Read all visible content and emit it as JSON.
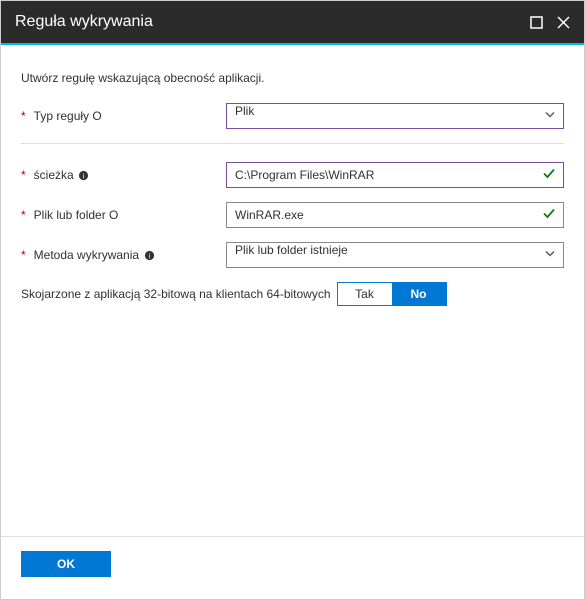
{
  "titlebar": {
    "title": "Reguła wykrywania"
  },
  "instruction": "Utwórz regułę wskazującą obecność aplikacji.",
  "fields": {
    "ruleType": {
      "label": "Typ reguły O",
      "value": "Plik"
    },
    "path": {
      "label": "ścieżka",
      "value": "C:\\Program Files\\WinRAR"
    },
    "fileOrFolder": {
      "label": "Plik lub folder O",
      "value": "WinRAR.exe"
    },
    "detectionMethod": {
      "label": "Metoda wykrywania",
      "value": "Plik lub folder istnieje"
    }
  },
  "assoc": {
    "label": "Skojarzone z aplikacją 32-bitową na klientach 64-bitowych",
    "yes": "Tak",
    "no": "No"
  },
  "footer": {
    "ok": "OK"
  }
}
